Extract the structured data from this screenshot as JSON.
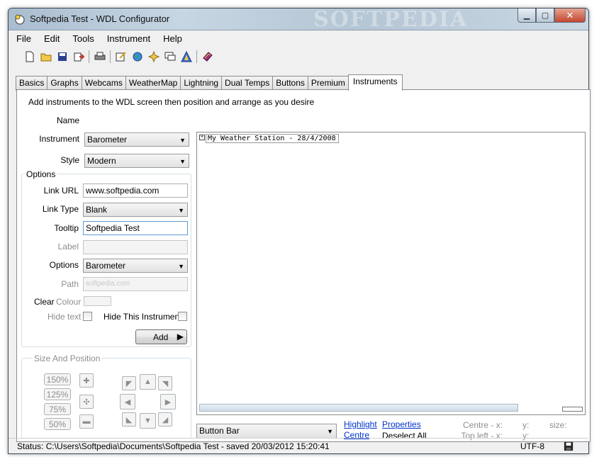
{
  "window": {
    "title": "Softpedia Test - WDL Configurator",
    "watermark": "SOFTPEDIA",
    "controls": {
      "minimize": "▁",
      "maximize": "▢",
      "close": "✕"
    }
  },
  "menu": [
    "File",
    "Edit",
    "Tools",
    "Instrument",
    "Help"
  ],
  "toolbar_icons": [
    "new-file-icon",
    "open-folder-icon",
    "save-icon",
    "export-icon",
    "print-icon",
    "edit-icon",
    "globe-icon",
    "sparkle-icon",
    "chat-icon",
    "triangle-icon",
    "book-icon"
  ],
  "tabs": [
    "Basics",
    "Graphs",
    "Webcams",
    "WeatherMap",
    "Lightning",
    "Dual Temps",
    "Buttons",
    "Premium",
    "Instruments"
  ],
  "active_tab": "Instruments",
  "instructions": "Add instruments to the WDL screen then position and arrange as you desire",
  "form": {
    "name_label": "Name",
    "instrument_label": "Instrument",
    "instrument_value": "Barometer",
    "style_label": "Style",
    "style_value": "Modern",
    "options_group": "Options",
    "link_url_label": "Link URL",
    "link_url_value": "www.softpedia.com",
    "link_type_label": "Link Type",
    "link_type_value": "Blank",
    "tooltip_label": "Tooltip",
    "tooltip_value": "Softpedia Test",
    "label_label": "Label",
    "options_label": "Options",
    "options_value": "Barometer",
    "path_label": "Path",
    "path_value": "softpedia.com",
    "clear_label": "Clear",
    "colour_label": "Colour",
    "hide_text_label": "Hide text",
    "hide_instrument_label": "Hide This Instrument",
    "add_button": "Add"
  },
  "size_position": {
    "group": "Size And Position",
    "zoom_buttons": [
      "150%",
      "125%",
      "75%",
      "50%"
    ]
  },
  "canvas": {
    "station_label": "My Weather Station - 28/4/2008"
  },
  "bottom": {
    "bar_select": "Button Bar",
    "highlight": "Highlight",
    "centre": "Centre",
    "properties": "Properties",
    "deselect_all": "Deselect All",
    "centre_x": "Centre - x:",
    "top_left_x": "Top left - x:",
    "y1": "y:",
    "y2": "y:",
    "size": "size:"
  },
  "status": {
    "text": "Status: C:\\Users\\Softpedia\\Documents\\Softpedia Test - saved 20/03/2012 15:20:41",
    "encoding": "UTF-8"
  }
}
